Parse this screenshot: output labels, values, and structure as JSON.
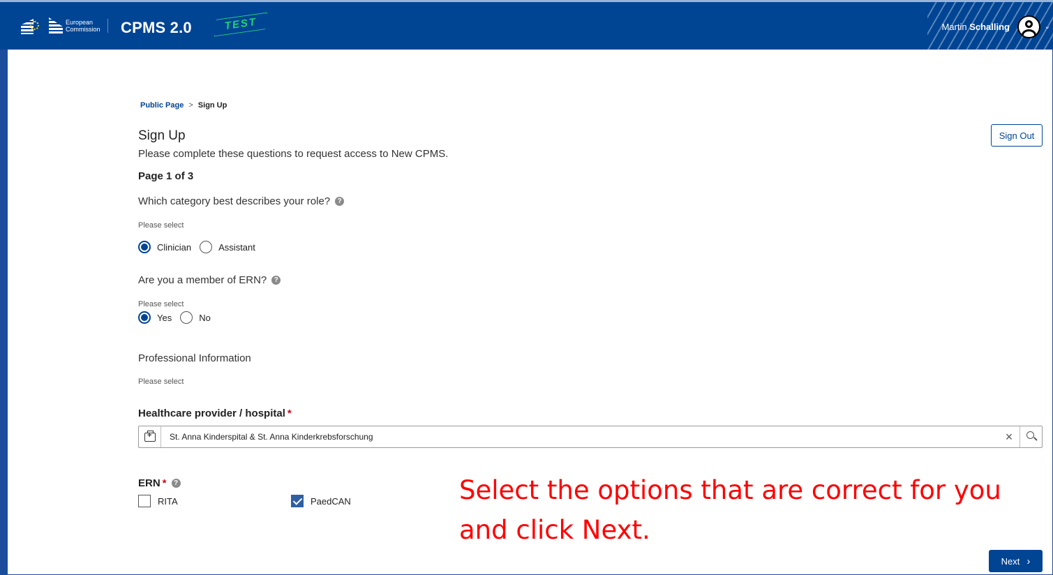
{
  "header": {
    "logo_text_line1": "European",
    "logo_text_line2": "Commission",
    "app_title": "CPMS 2.0",
    "env_stamp": "TEST",
    "user_first": "Martin",
    "user_last": "Schalling",
    "brand_color": "#004494"
  },
  "breadcrumb": {
    "parent": "Public Page",
    "separator": ">",
    "current": "Sign Up"
  },
  "page": {
    "title": "Sign Up",
    "intro": "Please complete these questions to request access to New CPMS.",
    "page_indicator": "Page 1 of 3",
    "sign_out_label": "Sign Out"
  },
  "role_question": {
    "label": "Which category best describes your role?",
    "hint": "Please select",
    "options": [
      {
        "label": "Clinician",
        "selected": true
      },
      {
        "label": "Assistant",
        "selected": false
      }
    ]
  },
  "ern_member_question": {
    "label": "Are you a member of ERN?",
    "hint": "Please select",
    "options": [
      {
        "label": "Yes",
        "selected": true
      },
      {
        "label": "No",
        "selected": false
      }
    ]
  },
  "professional": {
    "heading": "Professional Information",
    "hint": "Please select",
    "hospital_label": "Healthcare provider / hospital",
    "required_mark": "*",
    "hospital_value": "St. Anna Kinderspital & St. Anna Kinderkrebsforschung"
  },
  "ern": {
    "label": "ERN",
    "required_mark": "*",
    "options": [
      {
        "label": "RITA",
        "checked": false
      },
      {
        "label": "PaedCAN",
        "checked": true
      }
    ]
  },
  "annotation": {
    "line1": "Select the options that are correct for you",
    "line2": "and click Next."
  },
  "footer": {
    "next_label": "Next"
  }
}
